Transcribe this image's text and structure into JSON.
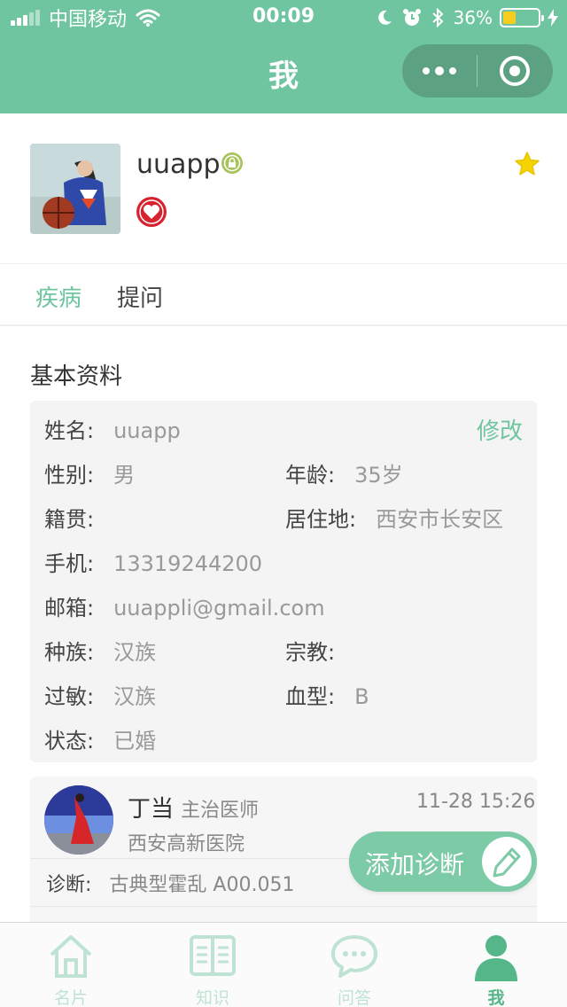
{
  "status_bar": {
    "carrier": "中国移动",
    "time": "00:09",
    "battery": "36%",
    "battery_level": 0.36
  },
  "nav": {
    "title": "我"
  },
  "profile": {
    "username": "uuapp"
  },
  "tabs": [
    {
      "label": "疾病",
      "active": true
    },
    {
      "label": "提问",
      "active": false
    }
  ],
  "section": {
    "title": "基本资料"
  },
  "info": {
    "edit_label": "修改",
    "name_label": "姓名:",
    "name": "uuapp",
    "gender_label": "性别:",
    "gender": "男",
    "age_label": "年龄:",
    "age": "35岁",
    "native_label": "籍贯:",
    "native": "",
    "residence_label": "居住地:",
    "residence": "西安市长安区",
    "phone_label": "手机:",
    "phone": "13319244200",
    "email_label": "邮箱:",
    "email": "uuappli@gmail.com",
    "ethnicity_label": "种族:",
    "ethnicity": "汉族",
    "religion_label": "宗教:",
    "religion": "",
    "allergy_label": "过敏:",
    "allergy": "汉族",
    "blood_label": "血型:",
    "blood": "B",
    "status_label": "状态:",
    "status": "已婚"
  },
  "diagnosis": {
    "doctor_name": "丁当",
    "doctor_title": "主治医师",
    "time": "11-28 15:26",
    "hospital": "西安高新医院",
    "diag_label": "诊断:",
    "diag_value": "古典型霍乱 A00.051"
  },
  "add_button": {
    "label": "添加诊断"
  },
  "tabbar": [
    {
      "label": "名片",
      "icon": "house-icon"
    },
    {
      "label": "知识",
      "icon": "book-icon"
    },
    {
      "label": "问答",
      "icon": "chat-bubble-icon"
    },
    {
      "label": "我",
      "icon": "person-icon"
    }
  ],
  "colors": {
    "brand": "#6fc59f",
    "accent_text": "#6fc59f",
    "tab_inactive": "#bfe3d2",
    "heart": "#d8232f",
    "star": "#f5d300"
  }
}
